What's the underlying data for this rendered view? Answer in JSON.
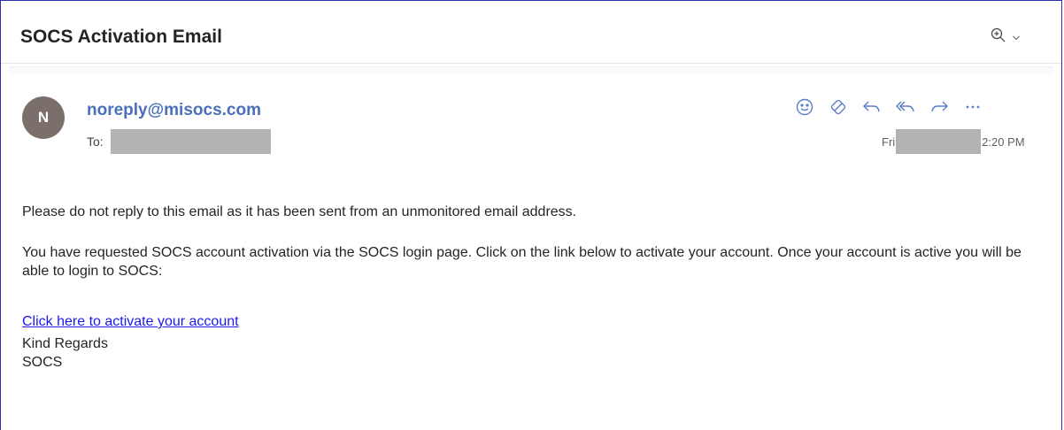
{
  "subject": "SOCS Activation Email",
  "header": {
    "zoom_icon": "zoom-in-icon",
    "zoom_chevron": "chevron-down-icon"
  },
  "sender": {
    "avatar_initial": "N",
    "email": "noreply@misocs.com",
    "to_label": "To:"
  },
  "date": {
    "day": "Fri",
    "time": "2:20 PM"
  },
  "actions": [
    "smiley-icon",
    "sensitivity-icon",
    "reply-icon",
    "reply-all-icon",
    "forward-icon",
    "more-icon"
  ],
  "body": {
    "line1": "Please do not reply to this email as it has been sent from an unmonitored email address.",
    "line2": "You have requested SOCS account activation via the SOCS login page. Click on the link below to activate your account. Once your account is active you will be able to login to SOCS:",
    "link_text": "Click here to activate your account",
    "closing": "Kind Regards",
    "signature": "SOCS"
  },
  "colors": {
    "sender": "#4a70b9",
    "icon": "#5b7fc7",
    "link": "#1a1aee",
    "avatar": "#7a6f6b"
  }
}
